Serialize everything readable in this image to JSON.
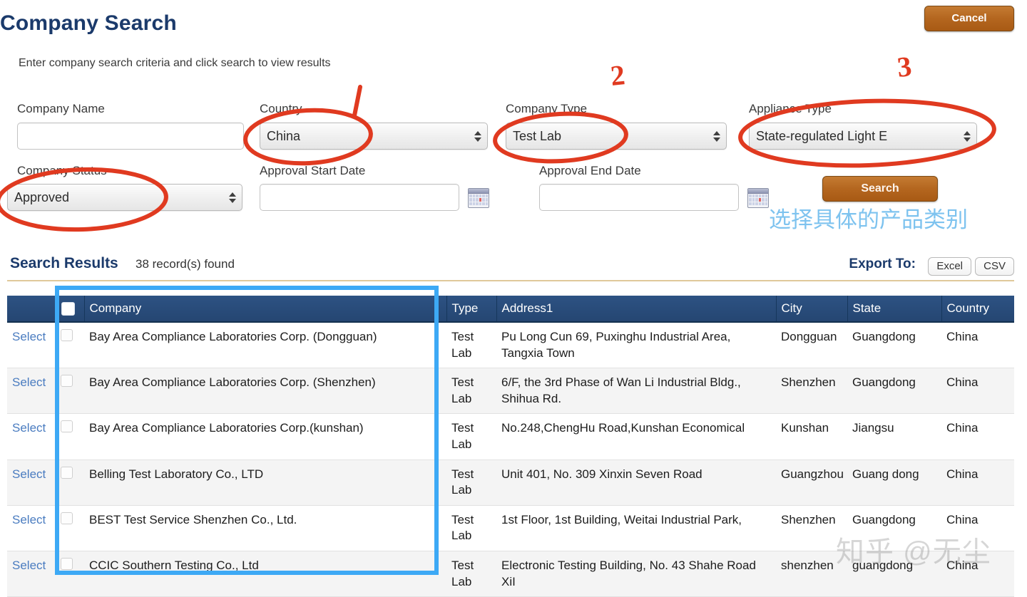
{
  "header": {
    "title": "Company Search",
    "cancel_label": "Cancel",
    "subtitle": "Enter company search criteria and click search to view results"
  },
  "form": {
    "company_name": {
      "label": "Company Name",
      "value": "",
      "placeholder": ""
    },
    "country": {
      "label": "Country",
      "value": "China"
    },
    "company_type": {
      "label": "Company Type",
      "value": "Test Lab"
    },
    "appliance_type": {
      "label": "Appliance Type",
      "value": "State-regulated Light E"
    },
    "company_status": {
      "label": "Company Status",
      "value": "Approved"
    },
    "approval_start_date": {
      "label": "Approval Start Date",
      "value": "",
      "placeholder": ""
    },
    "approval_end_date": {
      "label": "Approval End Date",
      "value": "",
      "placeholder": ""
    },
    "search_label": "Search",
    "calendar_icon": "calendar-icon"
  },
  "results": {
    "title": "Search Results",
    "count_text": "38 record(s) found",
    "export_label": "Export To:",
    "export_excel": "Excel",
    "export_csv": "CSV",
    "columns": [
      "",
      "",
      "Company",
      "Type",
      "Address1",
      "City",
      "State",
      "Country"
    ],
    "rows": [
      {
        "select": "Select",
        "company": "Bay Area Compliance Laboratories Corp. (Dongguan)",
        "type": "Test Lab",
        "address1": "Pu Long Cun 69, Puxinghu Industrial Area, Tangxia Town",
        "city": "Dongguan",
        "state": "Guangdong",
        "country": "China"
      },
      {
        "select": "Select",
        "company": "Bay Area Compliance Laboratories Corp. (Shenzhen)",
        "type": "Test Lab",
        "address1": "6/F, the 3rd Phase of Wan Li Industrial Bldg., Shihua Rd.",
        "city": "Shenzhen",
        "state": "Guangdong",
        "country": "China"
      },
      {
        "select": "Select",
        "company": "Bay Area Compliance Laboratories Corp.(kunshan)",
        "type": "Test Lab",
        "address1": "No.248,ChengHu Road,Kunshan Economical",
        "city": "Kunshan",
        "state": "Jiangsu",
        "country": "China"
      },
      {
        "select": "Select",
        "company": "Belling Test Laboratory Co., LTD",
        "type": "Test Lab",
        "address1": "Unit 401, No. 309 Xinxin Seven Road",
        "city": "Guangzhou",
        "state": "Guang dong",
        "country": "China"
      },
      {
        "select": "Select",
        "company": "BEST Test Service Shenzhen Co., Ltd.",
        "type": "Test Lab",
        "address1": "1st Floor, 1st Building, Weitai Industrial Park,",
        "city": "Shenzhen",
        "state": "Guangdong",
        "country": "China"
      },
      {
        "select": "Select",
        "company": "CCIC Southern Testing Co., Ltd",
        "type": "Test Lab",
        "address1": "Electronic Testing Building, No. 43 Shahe Road XiI",
        "city": "shenzhen",
        "state": "guangdong",
        "country": "China"
      }
    ]
  },
  "annotations": {
    "marker_1": "1",
    "marker_2": "2",
    "marker_3": "3",
    "chinese_note": "选择具体的产品类别",
    "marker_color": "#e03a20",
    "note_color": "#7ec3ef",
    "highlight_box_color": "#3da9f5"
  },
  "watermark": {
    "text": "知乎 @无尘"
  },
  "theme": {
    "brand_blue": "#1b3a6b",
    "header_row_blue": "#2d5283",
    "button_orange": "#b4661f",
    "link_blue": "#4a7cc0",
    "divider_gold": "#e0c89a"
  }
}
